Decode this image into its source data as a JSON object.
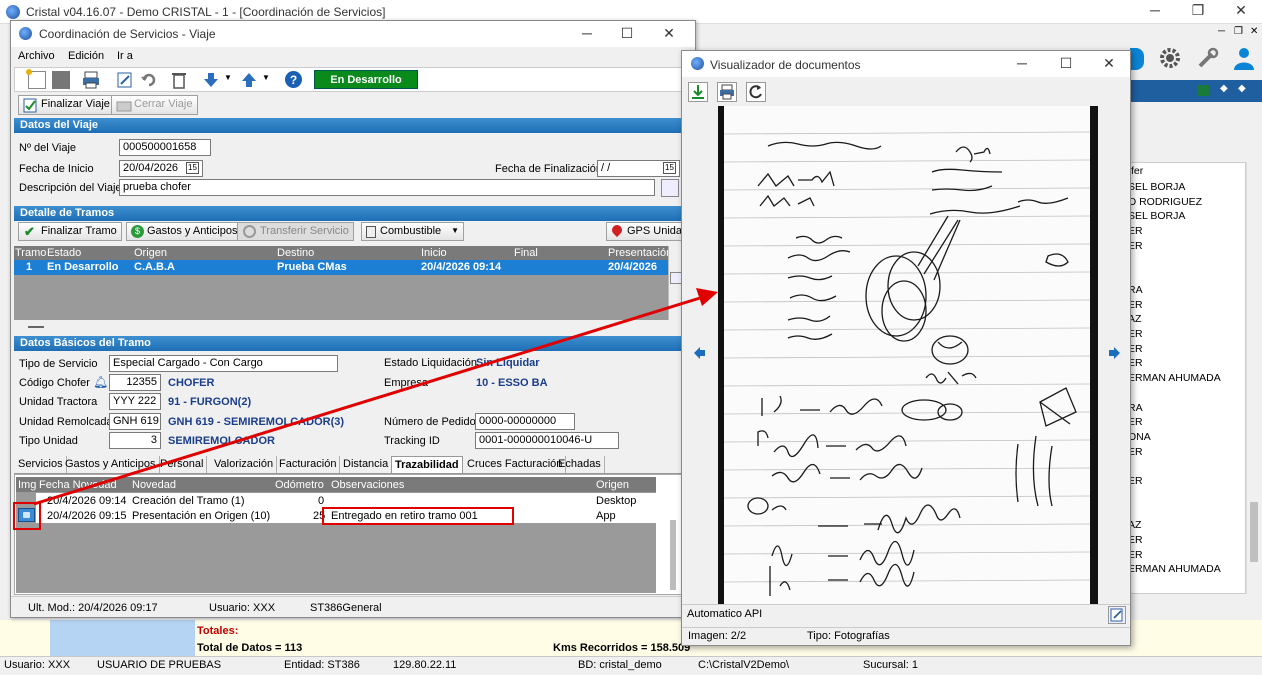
{
  "main_window": {
    "title": "Cristal v04.16.07 - Demo CRISTAL - 1 - [Coordinación de Servicios]"
  },
  "viaje_window": {
    "title": "Coordinación de Servicios - Viaje",
    "menu": [
      "Archivo",
      "Edición",
      "Ir a"
    ],
    "status_badge": "En Desarrollo",
    "finalizar_viaje": "Finalizar Viaje",
    "cerrar_viaje": "Cerrar Viaje",
    "datos_viaje": {
      "header": "Datos del Viaje",
      "nro_label": "Nº del Viaje",
      "nro_value": "000500001658",
      "fecha_inicio_label": "Fecha de Inicio",
      "fecha_inicio_value": "20/04/2026",
      "fecha_fin_label": "Fecha de Finalización",
      "fecha_fin_value": " / /",
      "desc_label": "Descripción del Viaje",
      "desc_value": "prueba chofer"
    },
    "tramos": {
      "header": "Detalle de Tramos",
      "buttons": [
        "Finalizar Tramo",
        "Gastos y Anticipos",
        "Transferir Servicio",
        "Combustible",
        "GPS Unidad"
      ],
      "columns": [
        "Tramo",
        "Estado",
        "Origen",
        "Destino",
        "Inicio",
        "Final",
        "Presentación"
      ],
      "row": [
        "1",
        "En Desarrollo",
        "C.A.B.A",
        "Prueba CMas",
        "20/4/2026 09:14",
        "",
        "20/4/2026"
      ]
    },
    "datos_tramo": {
      "header": "Datos Básicos del Tramo",
      "tipo_servicio_label": "Tipo de Servicio",
      "tipo_servicio_value": "Especial Cargado - Con Cargo",
      "codigo_chofer_label": "Código Chofer",
      "codigo_chofer_value": "12355",
      "chofer_desc": "CHOFER",
      "tractora_label": "Unidad Tractora",
      "tractora_value": "YYY 222",
      "tractora_desc": "91 - FURGON(2)",
      "remolcada_label": "Unidad Remolcada",
      "remolcada_value": "GNH 619",
      "remolcada_desc": "GNH 619 - SEMIREMOLCADOR(3)",
      "tipo_unidad_label": "Tipo Unidad",
      "tipo_unidad_value": "3",
      "tipo_unidad_desc": "SEMIREMOLCADOR",
      "estado_liq_label": "Estado Liquidación",
      "estado_liq_value": "Sin Liquidar",
      "empresa_label": "Empresa",
      "empresa_value": "10 - ESSO BA",
      "pedido_label": "Número de Pedido",
      "pedido_value": "0000-00000000",
      "tracking_label": "Tracking ID",
      "tracking_value": "0001-000000010046-U"
    },
    "tabs": [
      "Servicios",
      "Gastos y Anticipos",
      "Personal",
      "Valorización",
      "Facturación",
      "Distancia",
      "Trazabilidad",
      "Cruces Facturación",
      "Echadas"
    ],
    "trace_columns": [
      "Img",
      "Fecha Novedad",
      "Novedad",
      "Odómetro",
      "Observaciones",
      "Origen"
    ],
    "trace_rows": [
      [
        "",
        "20/4/2026 09:14",
        "Creación del Tramo (1)",
        "0",
        "",
        "Desktop"
      ],
      [
        "",
        "20/4/2026 09:15",
        "Presentación en Origen (10)",
        "25",
        "Entregado en retiro tramo 001",
        "App"
      ]
    ],
    "footer": {
      "ult_mod": "Ult. Mod.: 20/4/2026 09:17",
      "usuario": "Usuario: XXX",
      "general": "ST386General"
    }
  },
  "visor": {
    "title": "Visualizador de documentos",
    "caption": "Automatico API",
    "imagen": "Imagen: 2/2",
    "tipo": "Tipo: Fotografías"
  },
  "background_list": {
    "header": "fer",
    "names": [
      "SEL BORJA",
      "O RODRIGUEZ",
      "SEL BORJA",
      "ER",
      "ER",
      "",
      "",
      "RA",
      "ER",
      "AZ",
      "ER",
      "ER",
      "ER",
      "ERMAN AHUMADA",
      "",
      "RA",
      "ER",
      "ONA",
      "ER",
      "",
      "ER",
      "",
      "",
      "AZ",
      "ER",
      "ER",
      "ERMAN AHUMADA"
    ]
  },
  "totals": {
    "label": "Totales:",
    "total_datos": "Total de Datos = 113",
    "kms": "Kms Recorridos = 158.509"
  },
  "statusbar": [
    "Usuario: XXX",
    "USUARIO DE PRUEBAS",
    "Entidad: ST386",
    "129.80.22.11",
    "BD: cristal_demo",
    "C:\\CristalV2Demo\\",
    "Sucursal: 1"
  ],
  "colors": {
    "accent": "#1f6eb5",
    "highlight_row": "#1c7fd4",
    "badge_green": "#0b8a1c",
    "arrow_red": "#e00000"
  }
}
